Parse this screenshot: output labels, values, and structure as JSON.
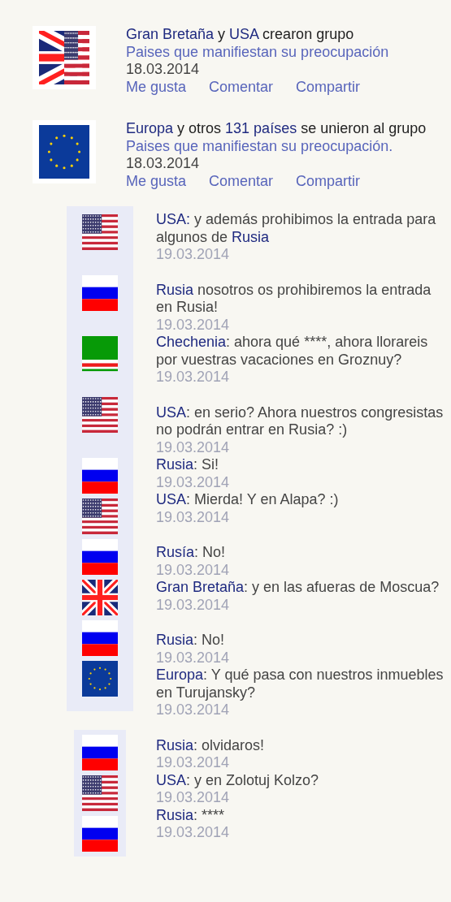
{
  "posts": [
    {
      "flag": {
        "kind": "gb-usa"
      },
      "headline": [
        {
          "text": "Gran Bretaña",
          "kind": "name"
        },
        {
          "text": " y ",
          "kind": "plain"
        },
        {
          "text": "USA",
          "kind": "name"
        },
        {
          "text": " crearon grupo",
          "kind": "plain"
        }
      ],
      "group": "Paises que manifiestan su preocupación",
      "date": "18.03.2014",
      "actions": [
        "Me gusta",
        "Comentar",
        "Compartir"
      ]
    },
    {
      "flag": {
        "kind": "eu"
      },
      "headline": [
        {
          "text": "Europa",
          "kind": "name"
        },
        {
          "text": " y otros ",
          "kind": "plain"
        },
        {
          "text": "131 países",
          "kind": "name"
        },
        {
          "text": " se unieron al grupo",
          "kind": "plain"
        }
      ],
      "group": "Paises que manifiestan su preocupación.",
      "date": "18.03.2014",
      "actions": [
        "Me gusta",
        "Comentar",
        "Compartir"
      ]
    }
  ],
  "threads": [
    {
      "flags": [
        {
          "kind": "usa"
        },
        {
          "kind": "russia"
        },
        {
          "kind": "chechnya"
        },
        {
          "kind": "usa"
        },
        {
          "kind": "russia"
        },
        {
          "kind": "usa"
        },
        {
          "kind": "russia"
        },
        {
          "kind": "gb"
        },
        {
          "kind": "russia"
        },
        {
          "kind": "eu"
        }
      ],
      "blocks": [
        {
          "messages": [
            {
              "parts": [
                {
                  "text": "USA:",
                  "kind": "name"
                },
                {
                  "text": " y además prohibimos la entrada para algunos de ",
                  "kind": "plain"
                },
                {
                  "text": "Rusia",
                  "kind": "name"
                }
              ],
              "date": "19.03.2014"
            }
          ]
        },
        {
          "messages": [
            {
              "parts": [
                {
                  "text": "Rusia",
                  "kind": "name"
                },
                {
                  "text": " nosotros os prohibiremos la entrada en Rusia!",
                  "kind": "plain"
                }
              ],
              "date": "19.03.2014"
            },
            {
              "parts": [
                {
                  "text": "Chechenia",
                  "kind": "name"
                },
                {
                  "text": ": ahora qué ****, ahora llorareis por vuestras vacaciones en Groznuy?",
                  "kind": "plain"
                }
              ],
              "date": "19.03.2014"
            }
          ]
        },
        {
          "messages": [
            {
              "parts": [
                {
                  "text": "USA",
                  "kind": "name"
                },
                {
                  "text": ": en serio? Ahora nuestros congresistas no podrán entrar en Rusia? :)",
                  "kind": "plain"
                }
              ],
              "date": "19.03.2014"
            },
            {
              "parts": [
                {
                  "text": "Rusia",
                  "kind": "name"
                },
                {
                  "text": ": Si!",
                  "kind": "plain"
                }
              ],
              "date": "19.03.2014"
            },
            {
              "parts": [
                {
                  "text": "USA",
                  "kind": "name"
                },
                {
                  "text": ": Mierda! Y en Alapa? :)",
                  "kind": "plain"
                }
              ],
              "date": "19.03.2014"
            }
          ]
        },
        {
          "messages": [
            {
              "parts": [
                {
                  "text": "Rusía",
                  "kind": "name"
                },
                {
                  "text": ": No!",
                  "kind": "plain"
                }
              ],
              "date": "19.03.2014"
            },
            {
              "parts": [
                {
                  "text": "Gran Bretaña",
                  "kind": "name"
                },
                {
                  "text": ": y en las afueras de Moscua?",
                  "kind": "plain"
                }
              ],
              "date": "19.03.2014"
            }
          ]
        },
        {
          "messages": [
            {
              "parts": [
                {
                  "text": "Rusia",
                  "kind": "name"
                },
                {
                  "text": ": No!",
                  "kind": "plain"
                }
              ],
              "date": "19.03.2014"
            },
            {
              "parts": [
                {
                  "text": "Europa",
                  "kind": "name"
                },
                {
                  "text": ": Y qué pasa con nuestros inmuebles en Turujansky?",
                  "kind": "plain"
                }
              ],
              "date": "19.03.2014"
            }
          ]
        }
      ]
    },
    {
      "flags": [
        {
          "kind": "russia"
        },
        {
          "kind": "usa"
        },
        {
          "kind": "russia"
        }
      ],
      "blocks": [
        {
          "messages": [
            {
              "parts": [
                {
                  "text": "Rusia",
                  "kind": "name"
                },
                {
                  "text": ": olvidaros!",
                  "kind": "plain"
                }
              ],
              "date": "19.03.2014"
            },
            {
              "parts": [
                {
                  "text": "USA",
                  "kind": "name"
                },
                {
                  "text": ": y en Zolotuj Kolzo?",
                  "kind": "plain"
                }
              ],
              "date": "19.03.2014"
            },
            {
              "parts": [
                {
                  "text": "Rusia",
                  "kind": "name"
                },
                {
                  "text": ": ****",
                  "kind": "plain"
                }
              ],
              "date": "19.03.2014"
            }
          ]
        }
      ]
    }
  ]
}
